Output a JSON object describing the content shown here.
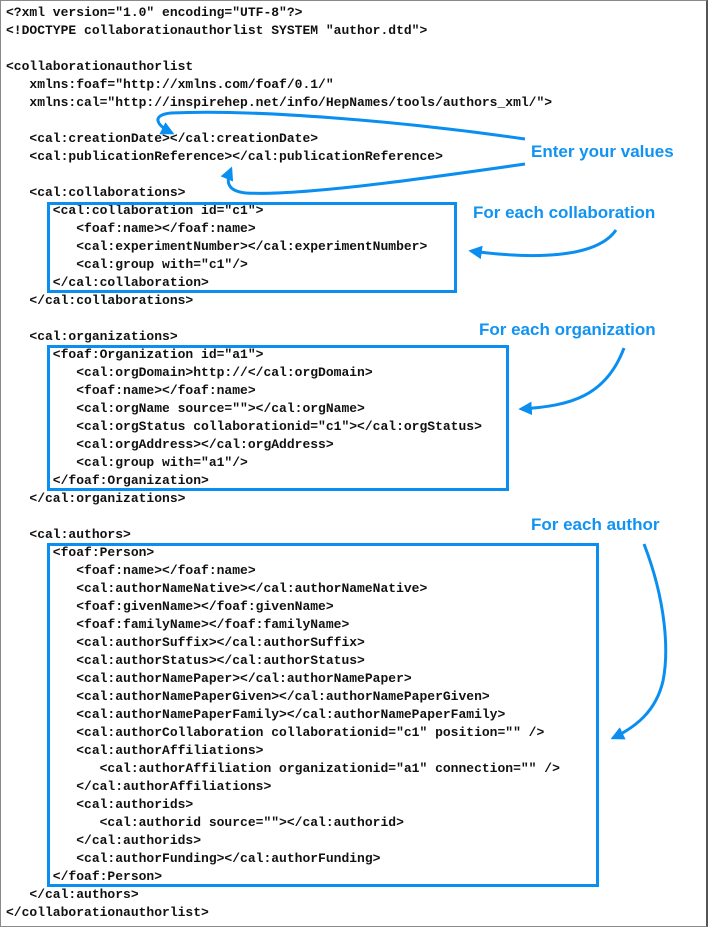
{
  "code_lines": [
    "<?xml version=\"1.0\" encoding=\"UTF-8\"?>",
    "<!DOCTYPE collaborationauthorlist SYSTEM \"author.dtd\">",
    "",
    "<collaborationauthorlist",
    "   xmlns:foaf=\"http://xmlns.com/foaf/0.1/\"",
    "   xmlns:cal=\"http://inspirehep.net/info/HepNames/tools/authors_xml/\">",
    "",
    "   <cal:creationDate></cal:creationDate>",
    "   <cal:publicationReference></cal:publicationReference>",
    "",
    "   <cal:collaborations>",
    "      <cal:collaboration id=\"c1\">",
    "         <foaf:name></foaf:name>",
    "         <cal:experimentNumber></cal:experimentNumber>",
    "         <cal:group with=\"c1\"/>",
    "      </cal:collaboration>",
    "   </cal:collaborations>",
    "",
    "   <cal:organizations>",
    "      <foaf:Organization id=\"a1\">",
    "         <cal:orgDomain>http://</cal:orgDomain>",
    "         <foaf:name></foaf:name>",
    "         <cal:orgName source=\"\"></cal:orgName>",
    "         <cal:orgStatus collaborationid=\"c1\"></cal:orgStatus>",
    "         <cal:orgAddress></cal:orgAddress>",
    "         <cal:group with=\"a1\"/>",
    "      </foaf:Organization>",
    "   </cal:organizations>",
    "",
    "   <cal:authors>",
    "      <foaf:Person>",
    "         <foaf:name></foaf:name>",
    "         <cal:authorNameNative></cal:authorNameNative>",
    "         <foaf:givenName></foaf:givenName>",
    "         <foaf:familyName></foaf:familyName>",
    "         <cal:authorSuffix></cal:authorSuffix>",
    "         <cal:authorStatus></cal:authorStatus>",
    "         <cal:authorNamePaper></cal:authorNamePaper>",
    "         <cal:authorNamePaperGiven></cal:authorNamePaperGiven>",
    "         <cal:authorNamePaperFamily></cal:authorNamePaperFamily>",
    "         <cal:authorCollaboration collaborationid=\"c1\" position=\"\" />",
    "         <cal:authorAffiliations>",
    "            <cal:authorAffiliation organizationid=\"a1\" connection=\"\" />",
    "         </cal:authorAffiliations>",
    "         <cal:authorids>",
    "            <cal:authorid source=\"\"></cal:authorid>",
    "         </cal:authorids>",
    "         <cal:authorFunding></cal:authorFunding>",
    "      </foaf:Person>",
    "   </cal:authors>",
    "</collaborationauthorlist>"
  ],
  "annotations": {
    "enter_values": "Enter your values",
    "each_collaboration": "For each collaboration",
    "each_organization": "For each organization",
    "each_author": "For each author"
  },
  "colors": {
    "accent": "#0a8ff0",
    "text": "#111111"
  }
}
